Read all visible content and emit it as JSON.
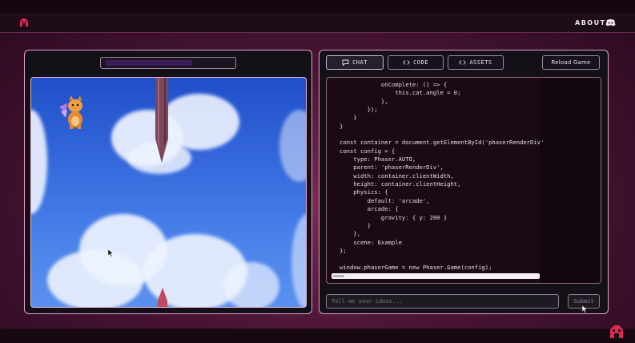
{
  "header": {
    "about_label": "ABOUT",
    "discord_icon": "discord-icon",
    "logo_icon": "app-logo-icon"
  },
  "tabs": [
    {
      "label": "CHAT",
      "icon": "chat-bubble-icon",
      "active": true
    },
    {
      "label": "CODE",
      "icon": "code-brackets-icon",
      "active": false
    },
    {
      "label": "ASSETS",
      "icon": "code-brackets-icon",
      "active": false
    }
  ],
  "reload_label": "Reload Game",
  "code_lines": [
    "            onComplete: () => {",
    "                this.cat.angle = 0;",
    "            },",
    "        });",
    "    }",
    "}",
    "",
    "const container = document.getElementById('phaserRenderDiv'",
    "const config = {",
    "    type: Phaser.AUTO,",
    "    parent: 'phaserRenderDiv',",
    "    width: container.clientWidth,",
    "    height: container.clientHeight,",
    "    physics: {",
    "        default: 'arcade',",
    "        arcade: {",
    "            gravity: { y: 200 }",
    "        }",
    "    },",
    "    scene: Example",
    "};",
    "",
    "window.phaserGame = new Phaser.Game(config);"
  ],
  "chat_input": {
    "placeholder": "Tell me your ideas...",
    "value": ""
  },
  "submit_label": "Submit",
  "colors": {
    "accent_border": "#e0a3c8",
    "sky": "#3a6ee0",
    "background": "#4a1534"
  }
}
